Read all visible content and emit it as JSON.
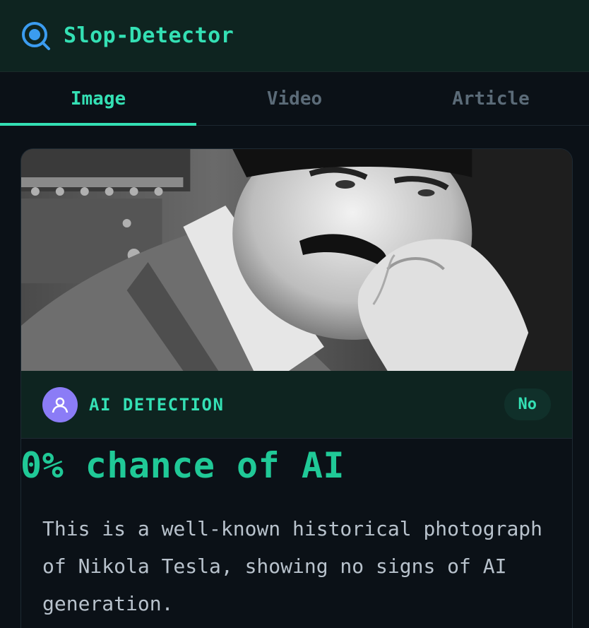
{
  "header": {
    "title": "Slop-Detector",
    "logo_icon": "search-target-icon",
    "accent_color": "#34e0b4"
  },
  "tabs": [
    {
      "label": "Image",
      "active": true
    },
    {
      "label": "Video",
      "active": false
    },
    {
      "label": "Article",
      "active": false
    }
  ],
  "result": {
    "photo": "historical black-and-white portrait photo",
    "detection_label": "AI DETECTION",
    "avatar_icon": "user-icon",
    "verdict": "No",
    "chance_text": "0% chance of AI",
    "explanation": "This is a well-known historical photograph of Nikola Tesla, showing no signs of AI generation."
  }
}
